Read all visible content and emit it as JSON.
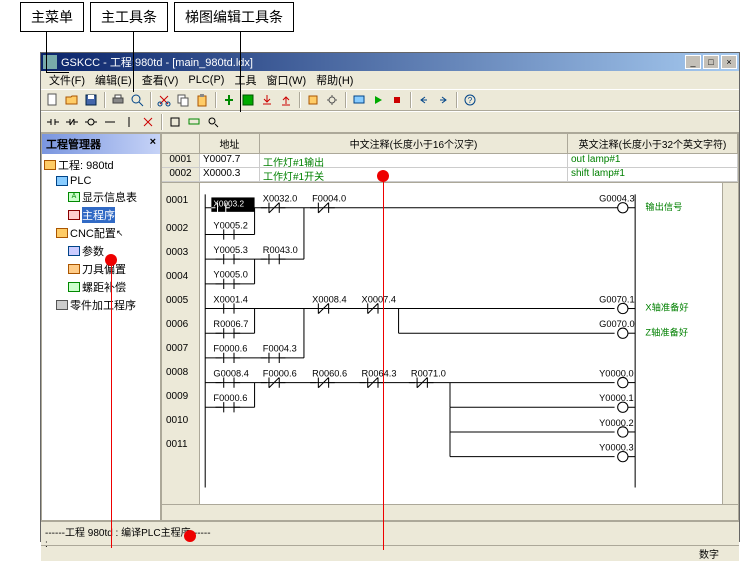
{
  "annotations": {
    "main_menu": "主菜单",
    "main_toolbar": "主工具条",
    "ladder_toolbar": "梯图编辑工具条"
  },
  "window": {
    "title": "GSKCC - 工程:980td - [main_980td.ldx]",
    "minimize": "_",
    "maximize": "□",
    "close": "×"
  },
  "menu": {
    "file": "文件(F)",
    "edit": "编辑(E)",
    "view": "查看(V)",
    "plc": "PLC(P)",
    "tools": "工具",
    "window": "窗口(W)",
    "help": "帮助(H)"
  },
  "project_panel": {
    "title": "工程管理器",
    "close": "×",
    "tree": {
      "root": "工程: 980td",
      "plc": "PLC",
      "info_table": "显示信息表",
      "main_prog": "主程序",
      "cnc_config": "CNC配置",
      "params": "参数",
      "tool_offset": "刀具偏置",
      "pitch_comp": "螺距补偿",
      "part_prog": "零件加工程序"
    }
  },
  "data_table": {
    "headers": {
      "addr": "地址",
      "chinese": "中文注释(长度小于16个汉字)",
      "english": "英文注释(长度小于32个英文字符)"
    },
    "rows": [
      {
        "num": "0001",
        "addr": "Y0007.7",
        "cn": "工作灯#1输出",
        "en": "out lamp#1"
      },
      {
        "num": "0002",
        "addr": "X0000.3",
        "cn": "工作灯#1开关",
        "en": "shift lamp#1"
      }
    ]
  },
  "ladder": {
    "row_nums": [
      "0001",
      "0002",
      "0003",
      "0004",
      "0005",
      "0006",
      "0007",
      "0008",
      "0009",
      "0010",
      "0011"
    ],
    "labels": {
      "x0003_2": "X0003.2",
      "x0032_0": "X0032.0",
      "f0004_0": "F0004.0",
      "y0005_2": "Y0005.2",
      "y0005_3": "Y0005.3",
      "r0043_0": "R0043.0",
      "y0005_0": "Y0005.0",
      "x0001_4": "X0001.4",
      "x0008_4": "X0008.4",
      "x0007_4": "X0007.4",
      "r0006_7": "R0006.7",
      "f0000_6": "F0000.6",
      "f0004_3": "F0004.3",
      "g0008_4": "G0008.4",
      "f0000_6b": "F0000.6",
      "r0060_6": "R0060.6",
      "r0064_3": "R0064.3",
      "r0071_0": "R0071.0",
      "f0000_6c": "F0000.6",
      "g0004_3": "G0004.3",
      "g0070_1": "G0070.1",
      "g0070_0": "G0070.0",
      "y0000_0": "Y0000.0",
      "y0000_1": "Y0000.1",
      "y0000_2": "Y0000.2",
      "y0000_3": "Y0000.3"
    },
    "comments": {
      "output_signal": "输出信号",
      "x_ready": "X轴准备好",
      "z_ready": "Z轴准备好"
    }
  },
  "bottom": {
    "compile_msg": "------工程 980td : 编译PLC主程序------",
    "status": "数字"
  },
  "other": {
    "colon": ":"
  }
}
